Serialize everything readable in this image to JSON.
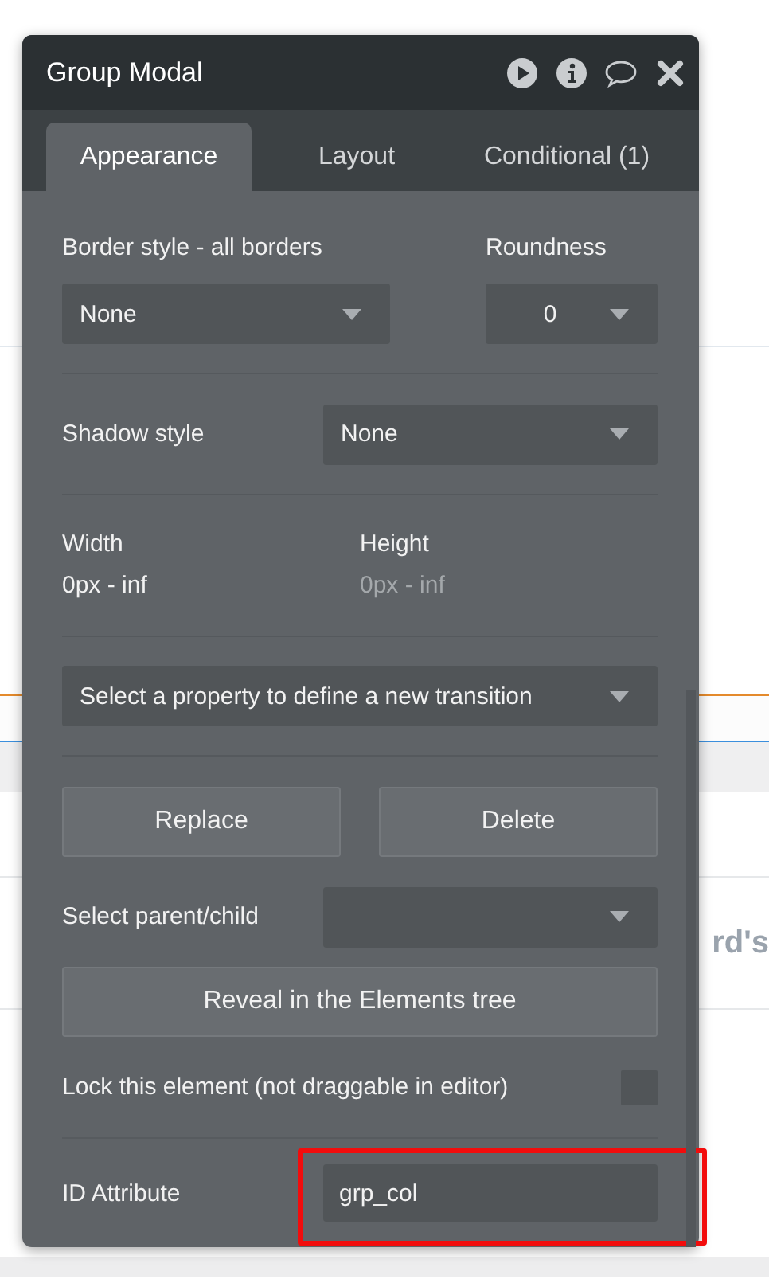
{
  "window": {
    "title": "Group Modal"
  },
  "tabs": [
    {
      "label": "Appearance",
      "selected": true
    },
    {
      "label": "Layout",
      "selected": false
    },
    {
      "label": "Conditional (1)",
      "selected": false
    }
  ],
  "border": {
    "label": "Border style - all borders",
    "value": "None"
  },
  "roundness": {
    "label": "Roundness",
    "value": "0"
  },
  "shadow": {
    "label": "Shadow style",
    "value": "None"
  },
  "width": {
    "label": "Width",
    "value": "0px - inf",
    "disabled": false
  },
  "height": {
    "label": "Height",
    "value": "0px - inf",
    "disabled": true
  },
  "transition": {
    "value": "Select a property to define a new transition"
  },
  "buttons": [
    "Replace",
    "Delete"
  ],
  "parent_child": {
    "label": "Select parent/child"
  },
  "reveal_button": "Reveal in the Elements tree",
  "lock": {
    "label": "Lock this element (not draggable in editor)",
    "checked": false
  },
  "id_attribute": {
    "label": "ID Attribute",
    "value": "grp_col",
    "highlighted": true
  },
  "background_text": "rd's"
}
